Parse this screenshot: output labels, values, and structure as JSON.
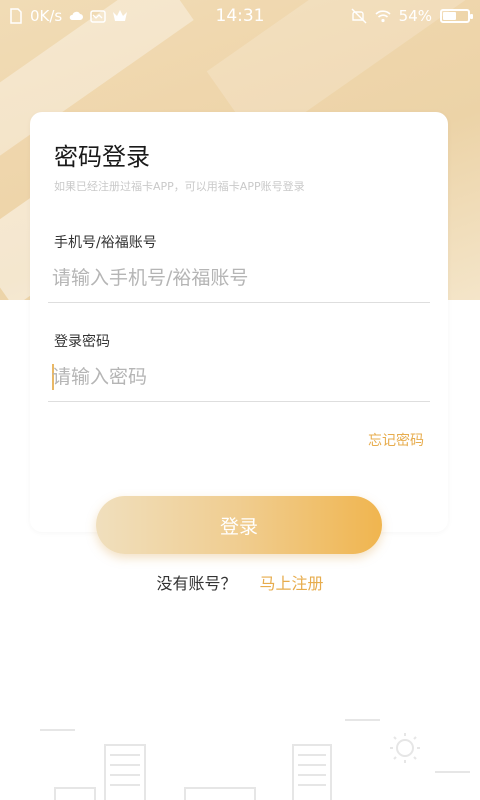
{
  "status_bar": {
    "speed": "0K/s",
    "time": "14:31",
    "battery": "54%",
    "battery_level": 0.54
  },
  "login": {
    "title": "密码登录",
    "subtitle": "如果已经注册过福卡APP，可以用福卡APP账号登录",
    "phone_label": "手机号/裕福账号",
    "phone_placeholder": "请输入手机号/裕福账号",
    "password_label": "登录密码",
    "password_placeholder": "请输入密码",
    "forgot_label": "忘记密码",
    "submit_label": "登录",
    "no_account_label": "没有账号？",
    "register_label": "马上注册"
  },
  "colors": {
    "accent": "#e7ac4d",
    "background_gold": "#efd6ac"
  }
}
